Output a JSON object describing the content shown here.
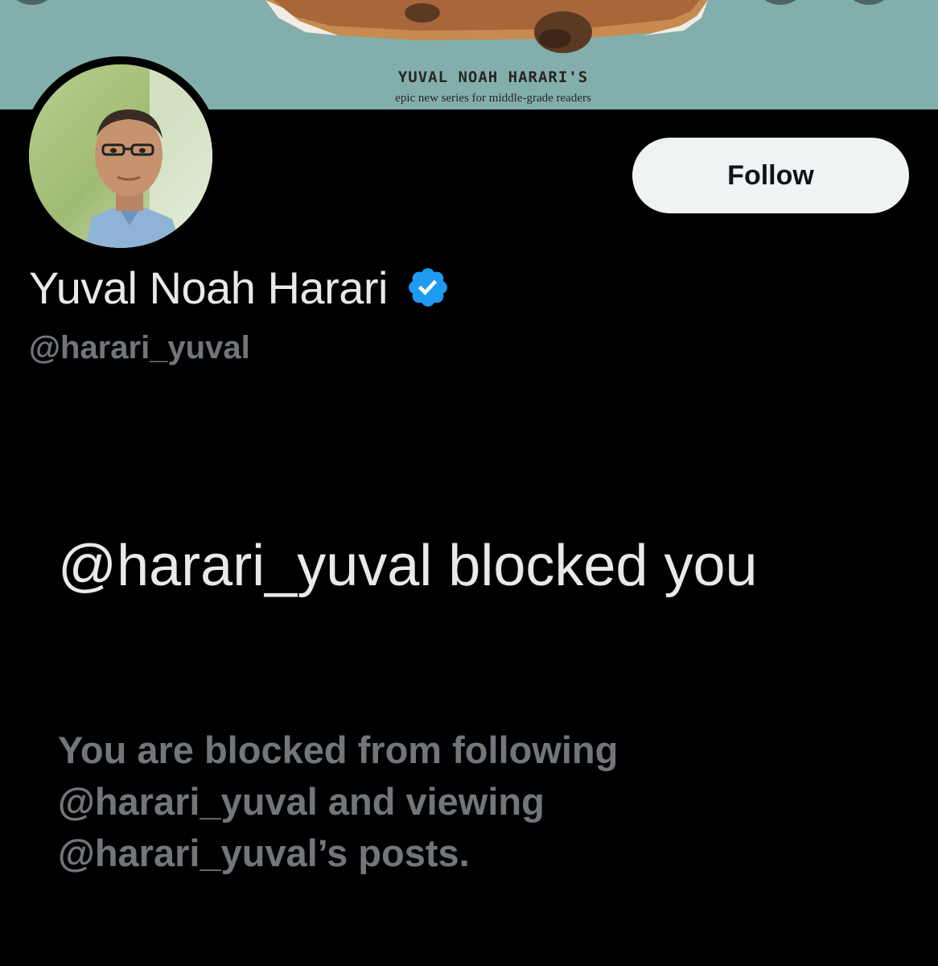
{
  "banner": {
    "title": "YUVAL NOAH HARARI'S",
    "subtitle": "epic new series for middle-grade readers",
    "background_color": "#86b3b0"
  },
  "profile": {
    "display_name": "Yuval Noah Harari",
    "handle": "@harari_yuval",
    "verified": true,
    "verified_icon": "verified-badge-icon",
    "verified_color": "#1d9bf0"
  },
  "actions": {
    "follow_label": "Follow"
  },
  "block_notice": {
    "title": "@harari_yuval blocked you",
    "description": "You are blocked from following @harari_yuval and viewing @harari_yuval’s posts."
  },
  "colors": {
    "background": "#000000",
    "primary_text": "#e7e9ea",
    "secondary_text": "#71767b",
    "button_bg": "#eff3f4",
    "button_text": "#0f1419"
  }
}
